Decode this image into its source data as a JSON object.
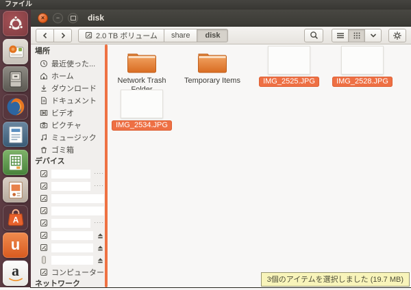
{
  "panel": {
    "app_menu": "ファイル"
  },
  "launcher": {
    "items": [
      "ubuntu-home",
      "startup-disk-creator",
      "files",
      "firefox",
      "libreoffice-writer",
      "libreoffice-calc",
      "libreoffice-impress",
      "software-center",
      "ubuntu-one",
      "amazon"
    ],
    "software_center_letter": "A",
    "ubuntu_one_letter": "u",
    "amazon_letter": "a"
  },
  "window": {
    "titlebar": {
      "title": "disk"
    },
    "toolbar": {
      "path": {
        "volume": "2.0 TB ボリューム",
        "share": "share",
        "disk": "disk"
      },
      "icons": [
        "back",
        "forward",
        "search",
        "view-list",
        "view-grid",
        "view-expander",
        "gear"
      ],
      "active_view": "grid"
    },
    "sidebar": {
      "places_heading": "場所",
      "places": [
        "最近使った...",
        "ホーム",
        "ダウンロード",
        "ドキュメント",
        "ビデオ",
        "ピクチャ",
        "ミュージック",
        "ゴミ箱"
      ],
      "devices_heading": "デバイス",
      "devices": {
        "count": 8,
        "labels_redacted": true,
        "truncated_rows": [
          1,
          2,
          5
        ],
        "eject_rows": [
          6,
          7,
          8
        ]
      },
      "device_trail": "····",
      "computer": "コンピューター",
      "network_heading": "ネットワーク"
    },
    "files": {
      "folders": [
        {
          "name": "Network Trash Folder",
          "selected": false
        },
        {
          "name": "Temporary Items",
          "selected": false
        }
      ],
      "images": [
        {
          "name": "IMG_2525.JPG",
          "selected": true
        },
        {
          "name": "IMG_2528.JPG",
          "selected": true
        },
        {
          "name": "IMG_2534.JPG",
          "selected": true
        }
      ]
    },
    "status_tooltip": "3個のアイテムを選択しました (19.7 MB)"
  },
  "colors": {
    "selection_orange": "#ee7044",
    "sidebar_scrollbar": "#ee7243",
    "status_bg": "#f8f4ba",
    "folder_orange": "#e07b2e"
  }
}
